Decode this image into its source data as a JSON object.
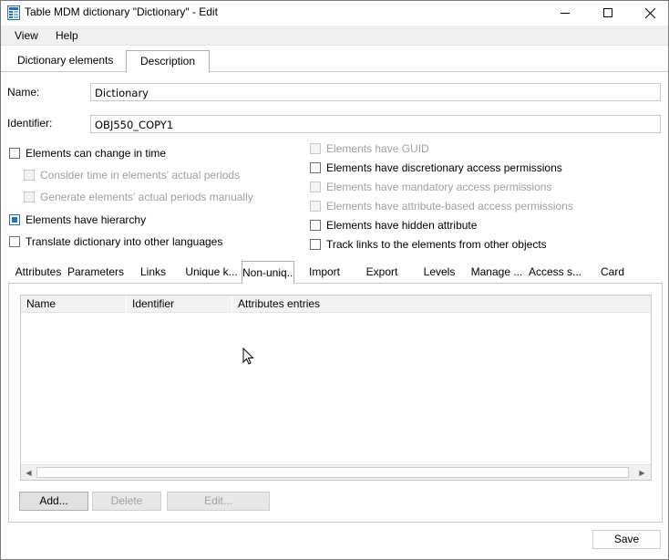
{
  "window": {
    "title": "Table MDM dictionary \"Dictionary\" - Edit",
    "icon": "table-dictionary-icon"
  },
  "menu": {
    "view": "View",
    "help": "Help"
  },
  "top_tabs": {
    "dictionary_elements": "Dictionary elements",
    "description": "Description",
    "active": "Description"
  },
  "form": {
    "name_label": "Name:",
    "name_value": "Dictionary",
    "identifier_label": "Identifier:",
    "identifier_value": "OBJ550_COPY1"
  },
  "options_left": [
    {
      "label": "Elements can change in time",
      "checked": false,
      "enabled": true
    },
    {
      "label": "Consider time in elements' actual periods",
      "checked": false,
      "enabled": false
    },
    {
      "label": "Generate elements' actual periods manually",
      "checked": false,
      "enabled": false
    },
    {
      "label": "Elements have hierarchy",
      "checked": true,
      "enabled": true
    },
    {
      "label": "Translate dictionary into other languages",
      "checked": false,
      "enabled": true
    }
  ],
  "options_right": [
    {
      "label": "Elements have GUID",
      "checked": false,
      "enabled": false
    },
    {
      "label": "Elements have discretionary access permissions",
      "checked": false,
      "enabled": true
    },
    {
      "label": "Elements have mandatory access permissions",
      "checked": false,
      "enabled": false
    },
    {
      "label": "Elements have attribute-based access permissions",
      "checked": false,
      "enabled": false
    },
    {
      "label": "Elements have hidden attribute",
      "checked": false,
      "enabled": true
    },
    {
      "label": "Track links to the elements from other objects",
      "checked": false,
      "enabled": true
    }
  ],
  "inner_tabs": {
    "attributes": "Attributes",
    "parameters": "Parameters",
    "links": "Links",
    "unique_keys": "Unique k...",
    "non_unique": "Non-uniq...",
    "import": "Import",
    "export": "Export",
    "levels": "Levels",
    "manage": "Manage ...",
    "access": "Access s...",
    "card": "Card",
    "active": "Non-uniq..."
  },
  "grid": {
    "columns": [
      "Name",
      "Identifier",
      "Attributes entries"
    ],
    "rows": []
  },
  "buttons": {
    "add": "Add...",
    "delete": "Delete",
    "edit": "Edit...",
    "save": "Save"
  },
  "colors": {
    "accent": "#1e73c8",
    "menubar_bg": "#f0f0f0",
    "grid_header_bg": "#f2f2f2"
  }
}
